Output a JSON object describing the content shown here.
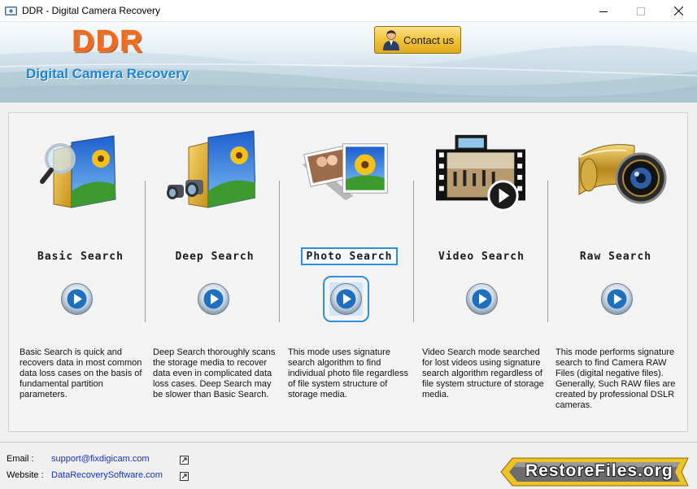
{
  "window": {
    "title": "DDR - Digital Camera Recovery",
    "controls": {
      "minimize": "─",
      "maximize": "☐",
      "close": "✕"
    }
  },
  "header": {
    "logo": "DDR",
    "subtitle": "Digital Camera Recovery",
    "contact_label": "Contact us",
    "colors": {
      "logo": "#ee6a1c",
      "subtitle": "#1e86cf",
      "contact_button": "#f1c33a"
    }
  },
  "modes": [
    {
      "title": "Basic Search",
      "icon": "magnifier-folder-icon",
      "description": "Basic Search is quick and recovers data in most common data loss cases on the basis of fundamental partition parameters."
    },
    {
      "title": "Deep Search",
      "icon": "binoculars-folder-icon",
      "description": "Deep Search thoroughly scans the storage media to recover data even in complicated data loss cases. Deep Search may be slower than Basic Search."
    },
    {
      "title": "Photo Search",
      "icon": "photos-stack-icon",
      "selected": true,
      "description": "This mode uses signature search algorithm to find individual photo file regardless of file system structure of storage media."
    },
    {
      "title": "Video Search",
      "icon": "video-film-icon",
      "description": "Video Search mode searched for lost videos using signature search algorithm regardless of file system structure of storage media."
    },
    {
      "title": "Raw Search",
      "icon": "camera-lens-film-icon",
      "description": "This mode performs signature search to find Camera RAW Files (digital negative files). Generally, Such RAW files are created by professional DSLR cameras."
    }
  ],
  "footer": {
    "email_label": "Email :",
    "email_value": "support@fixdigicam.com",
    "website_label": "Website :",
    "website_value": "DataRecoverySoftware.com",
    "badge_text": "RestoreFiles.org",
    "link_color": "#1330c8"
  }
}
